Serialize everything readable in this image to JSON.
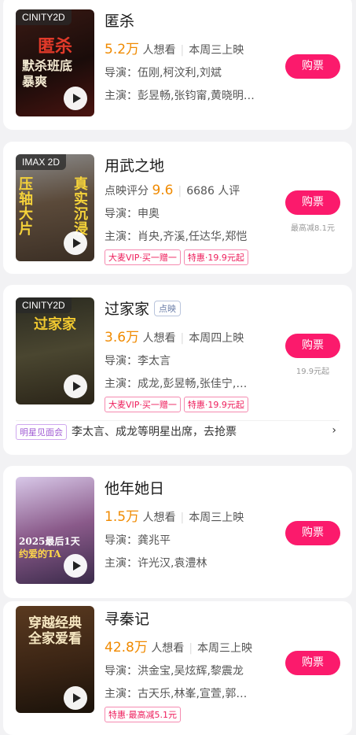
{
  "movies": [
    {
      "poster_format": "CINITY2D",
      "poster_text": [
        "匿杀",
        "默杀班底",
        "暴爽"
      ],
      "title": "匿杀",
      "want": "5.2万",
      "want_label": "人想看",
      "release": "本周三上映",
      "director": "导演：伍刚,柯汶利,刘斌",
      "cast": "主演：彭昱畅,张钧甯,黄晓明…",
      "buy_label": "购票"
    },
    {
      "poster_format": "IMAX 2D",
      "poster_text": [
        "压轴大片",
        "真实沉浸"
      ],
      "title": "用武之地",
      "score_label": "点映评分",
      "score": "9.6",
      "rating_count": "6686 人评",
      "director": "导演：申奥",
      "cast": "主演：肖央,齐溪,任达华,郑恺",
      "promos": [
        "大麦VIP·买一赠一",
        "特惠·19.9元起"
      ],
      "buy_label": "购票",
      "buy_sub": "最高减8.1元"
    },
    {
      "poster_format": "CINITY2D",
      "poster_text": [
        "过家家"
      ],
      "title": "过家家",
      "tag": "点映",
      "want": "3.6万",
      "want_label": "人想看",
      "release": "本周四上映",
      "director": "导演：李太言",
      "cast": "主演：成龙,彭昱畅,张佳宁,…",
      "promos": [
        "大麦VIP·买一赠一",
        "特惠·19.9元起"
      ],
      "buy_label": "购票",
      "buy_sub": "19.9元起",
      "meet_badge": "明星见面会",
      "meet_text": "李太言、成龙等明星出席，去抢票",
      "meet_arrow": "›"
    },
    {
      "poster_text": [
        "2025最后1天",
        "约爱的TA"
      ],
      "title": "他年她日",
      "want": "1.5万",
      "want_label": "人想看",
      "release": "本周三上映",
      "director": "导演：龚兆平",
      "cast": "主演：许光汉,袁澧林",
      "buy_label": "购票"
    },
    {
      "poster_text": [
        "穿越经典",
        "全家爱看"
      ],
      "title": "寻秦记",
      "want": "42.8万",
      "want_label": "人想看",
      "release": "本周三上映",
      "director": "导演：洪金宝,吴炫辉,黎震龙",
      "cast": "主演：古天乐,林峯,宣萱,郭…",
      "promos": [
        "特惠·最高减5.1元"
      ],
      "buy_label": "购票"
    }
  ],
  "colors": {
    "accent": "#fb1a6c",
    "want": "#f08a00"
  },
  "icons": {
    "play": "play-icon",
    "arrow": "chevron-right-icon"
  }
}
